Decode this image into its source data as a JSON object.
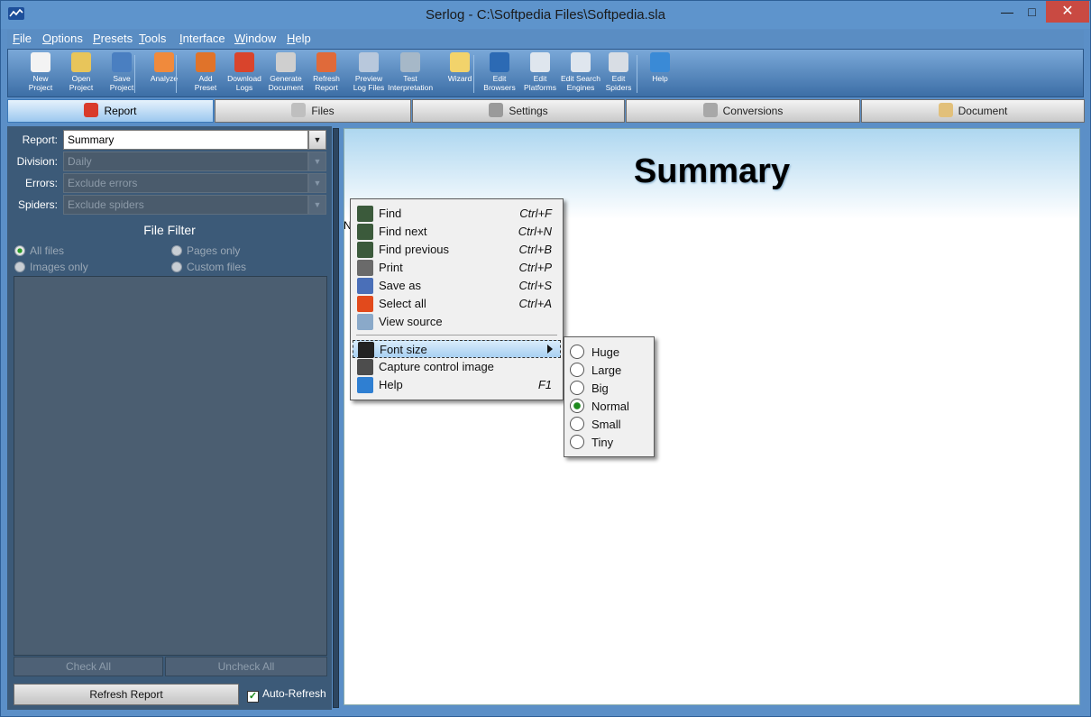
{
  "window": {
    "title": "Serlog - C:\\Softpedia Files\\Softpedia.sla",
    "minimize": "—",
    "maximize": "□",
    "close": "✕"
  },
  "menu": [
    "File",
    "Options",
    "Presets",
    "Tools",
    "Interface",
    "Window",
    "Help"
  ],
  "toolbar": [
    {
      "label1": "New",
      "label2": "Project",
      "icon": "new-project-icon",
      "color": "#f3f3f3"
    },
    {
      "label1": "Open",
      "label2": "Project",
      "icon": "open-project-icon",
      "color": "#e8c55a"
    },
    {
      "label1": "Save",
      "label2": "Project",
      "icon": "save-project-icon",
      "color": "#4a7fc1"
    },
    {
      "label1": "Analyze",
      "label2": "",
      "icon": "analyze-icon",
      "color": "#f08a3c"
    },
    {
      "label1": "Add",
      "label2": "Preset",
      "icon": "add-preset-icon",
      "color": "#e0732a"
    },
    {
      "label1": "Download",
      "label2": "Logs",
      "icon": "download-logs-icon",
      "color": "#d9442c"
    },
    {
      "label1": "Generate",
      "label2": "Document",
      "icon": "generate-document-icon",
      "color": "#cfcfcf"
    },
    {
      "label1": "Refresh",
      "label2": "Report",
      "icon": "refresh-report-icon",
      "color": "#e06a3a"
    },
    {
      "label1": "Preview",
      "label2": "Log Files",
      "icon": "preview-log-files-icon",
      "color": "#b8c8dc"
    },
    {
      "label1": "Test",
      "label2": "Interpretation",
      "icon": "test-interpretation-icon",
      "color": "#a6b8c8"
    },
    {
      "label1": "Wizard",
      "label2": "",
      "icon": "wizard-icon",
      "color": "#f2d36b"
    },
    {
      "label1": "Edit",
      "label2": "Browsers",
      "icon": "edit-browsers-icon",
      "color": "#2c6ab4"
    },
    {
      "label1": "Edit",
      "label2": "Platforms",
      "icon": "edit-platforms-icon",
      "color": "#dfe6ee"
    },
    {
      "label1": "Edit Search",
      "label2": "Engines",
      "icon": "edit-search-engines-icon",
      "color": "#dfe6ee"
    },
    {
      "label1": "Edit",
      "label2": "Spiders",
      "icon": "edit-spiders-icon",
      "color": "#d8dde4"
    },
    {
      "label1": "Help",
      "label2": "",
      "icon": "help-icon",
      "color": "#3a8ad6"
    }
  ],
  "tabs": [
    {
      "label": "Report",
      "icon": "report-pie-icon",
      "color": "#d93b2b"
    },
    {
      "label": "Files",
      "icon": "files-icon",
      "color": "#bfbfbf"
    },
    {
      "label": "Settings",
      "icon": "settings-gear-icon",
      "color": "#9a9a9a"
    },
    {
      "label": "Conversions",
      "icon": "conversions-cart-icon",
      "color": "#a8a8a8"
    },
    {
      "label": "Document",
      "icon": "document-scroll-icon",
      "color": "#e2c07a"
    }
  ],
  "filters": {
    "report": {
      "label": "Report:",
      "value": "Summary"
    },
    "division": {
      "label": "Division:",
      "value": "Daily"
    },
    "errors": {
      "label": "Errors:",
      "value": "Exclude errors"
    },
    "spiders": {
      "label": "Spiders:",
      "value": "Exclude spiders"
    },
    "dropdown_arrow": "▼"
  },
  "file_filter": {
    "title": "File Filter",
    "options": [
      "All files",
      "Pages only",
      "Images only",
      "Custom files"
    ],
    "selected": "All files"
  },
  "buttons": {
    "check_all": "Check All",
    "uncheck_all": "Uncheck All",
    "refresh_report": "Refresh Report",
    "auto_refresh": "Auto-Refresh",
    "auto_refresh_checked": "✓"
  },
  "document": {
    "title": "Summary",
    "partial_text": "N"
  },
  "context_menu": [
    {
      "label": "Find",
      "shortcut": "Ctrl+F",
      "icon": "binoculars-icon",
      "color": "#3b5a3b"
    },
    {
      "label": "Find next",
      "shortcut": "Ctrl+N",
      "icon": "binoculars-next-icon",
      "color": "#3b5a3b"
    },
    {
      "label": "Find previous",
      "shortcut": "Ctrl+B",
      "icon": "binoculars-previous-icon",
      "color": "#3b5a3b"
    },
    {
      "label": "Print",
      "shortcut": "Ctrl+P",
      "icon": "printer-icon",
      "color": "#6a6a6a"
    },
    {
      "label": "Save as",
      "shortcut": "Ctrl+S",
      "icon": "save-as-icon",
      "color": "#4a6fb8"
    },
    {
      "label": "Select all",
      "shortcut": "Ctrl+A",
      "icon": "select-all-icon",
      "color": "#e24a1c"
    },
    {
      "label": "View source",
      "shortcut": "",
      "icon": "view-source-icon",
      "color": "#8aa9c9"
    },
    {
      "label": "Font size",
      "shortcut": "",
      "icon": "font-size-icon",
      "color": "#222222"
    },
    {
      "label": "Capture control image",
      "shortcut": "",
      "icon": "camera-icon",
      "color": "#4d4d4d"
    },
    {
      "label": "Help",
      "shortcut": "F1",
      "icon": "help-icon",
      "color": "#2f7fd2"
    }
  ],
  "font_size_menu": {
    "options": [
      "Huge",
      "Large",
      "Big",
      "Normal",
      "Small",
      "Tiny"
    ],
    "selected": "Normal"
  }
}
